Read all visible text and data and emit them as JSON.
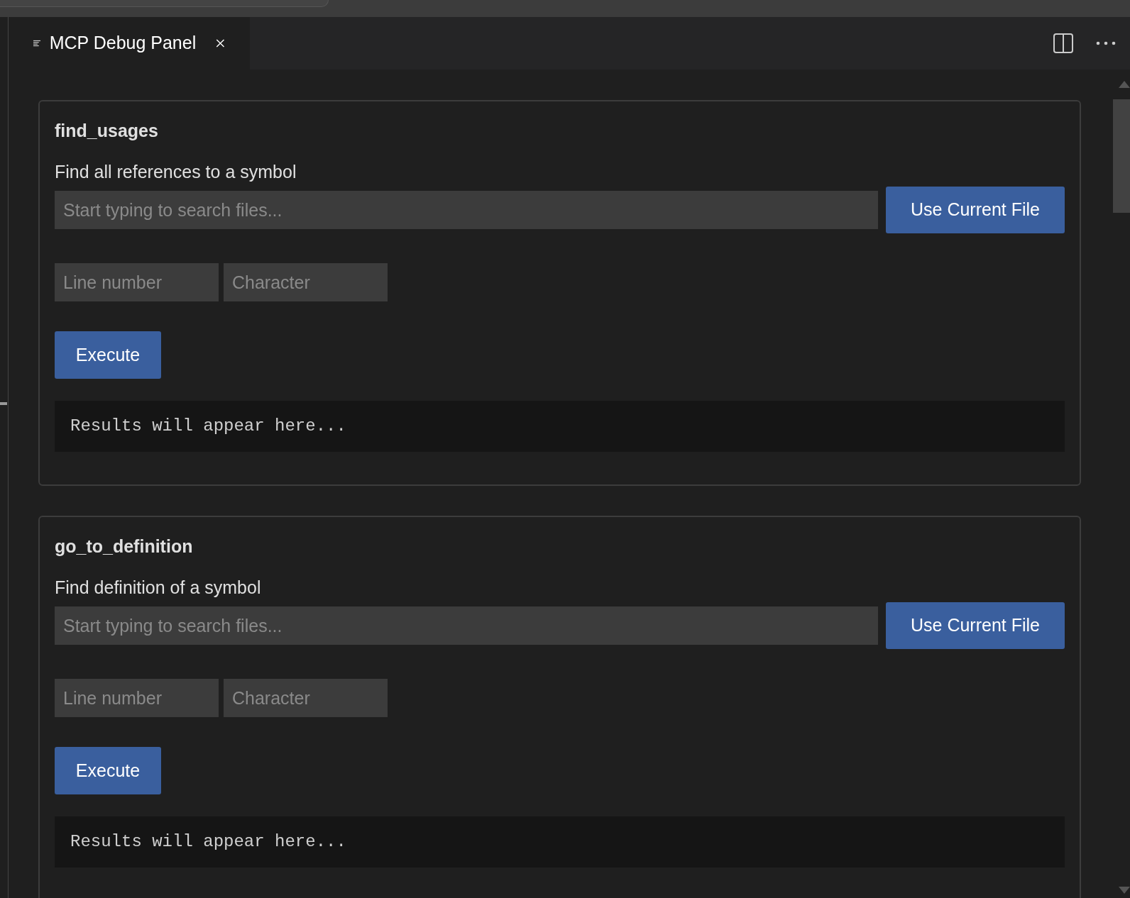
{
  "tab": {
    "label": "MCP Debug Panel",
    "selected": true
  },
  "tools": [
    {
      "name": "find_usages",
      "description": "Find all references to a symbol",
      "file_placeholder": "Start typing to search files...",
      "use_current_button": "Use Current File",
      "line_placeholder": "Line number",
      "character_placeholder": "Character",
      "execute_button": "Execute",
      "results": "Results will appear here..."
    },
    {
      "name": "go_to_definition",
      "description": "Find definition of a symbol",
      "file_placeholder": "Start typing to search files...",
      "use_current_button": "Use Current File",
      "line_placeholder": "Line number",
      "character_placeholder": "Character",
      "execute_button": "Execute",
      "results": "Results will appear here..."
    }
  ]
}
